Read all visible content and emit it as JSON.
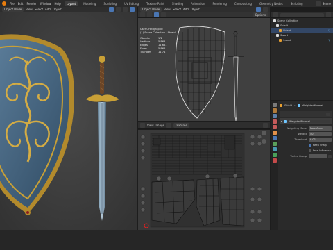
{
  "topbar": {
    "menus": [
      "File",
      "Edit",
      "Render",
      "Window",
      "Help"
    ],
    "workspaces": [
      "Layout",
      "Modeling",
      "Sculpting",
      "UV Editing",
      "Texture Paint",
      "Shading",
      "Animation",
      "Rendering",
      "Compositing",
      "Geometry Nodes",
      "Scripting"
    ],
    "active_workspace": "Layout",
    "scene_label": "Scene"
  },
  "left_view": {
    "mode": "Object Mode",
    "menus": [
      "View",
      "Select",
      "Add",
      "Object"
    ],
    "options_label": "Options"
  },
  "right_view": {
    "mode": "Object Mode",
    "menus": [
      "View",
      "Select",
      "Add",
      "Object"
    ],
    "options_label": "Options",
    "overlay_title": "User Orthographic",
    "overlay_collection": "(1) Scene Collection | Shield",
    "stats": [
      {
        "label": "Objects",
        "value": "1/2"
      },
      {
        "label": "Vertices",
        "value": "5,863"
      },
      {
        "label": "Edges",
        "value": "11,661"
      },
      {
        "label": "Faces",
        "value": "5,866"
      },
      {
        "label": "Triangles",
        "value": "11,747"
      }
    ]
  },
  "uv_view": {
    "menus": [
      "View",
      "Image"
    ],
    "image_name": "textures"
  },
  "outliner": {
    "search_placeholder": "",
    "items": [
      {
        "label": "Scene Collection",
        "level": 0
      },
      {
        "label": "Shield",
        "level": 1
      },
      {
        "label": "Shield",
        "level": 2
      },
      {
        "label": "Sword",
        "level": 1
      },
      {
        "label": "Sword",
        "level": 2
      }
    ]
  },
  "properties": {
    "breadcrumb_object": "Shield",
    "breadcrumb_modifier": "WeightedNormal",
    "modifier_name": "WeightedNormal",
    "rows": [
      {
        "key": "Weighting Mode",
        "value": "Face Area"
      },
      {
        "key": "Weight",
        "value": "50"
      },
      {
        "key": "Threshold",
        "value": "0.01"
      }
    ],
    "checkboxes": [
      "Keep Sharp",
      "Face Influence"
    ],
    "vertex_group_label": "Vertex Group"
  },
  "colors": {
    "accent": "#e87d0d",
    "selection": "#4a76b3",
    "shield_blue": "#4a6f8f",
    "gold": "#c9a036"
  }
}
